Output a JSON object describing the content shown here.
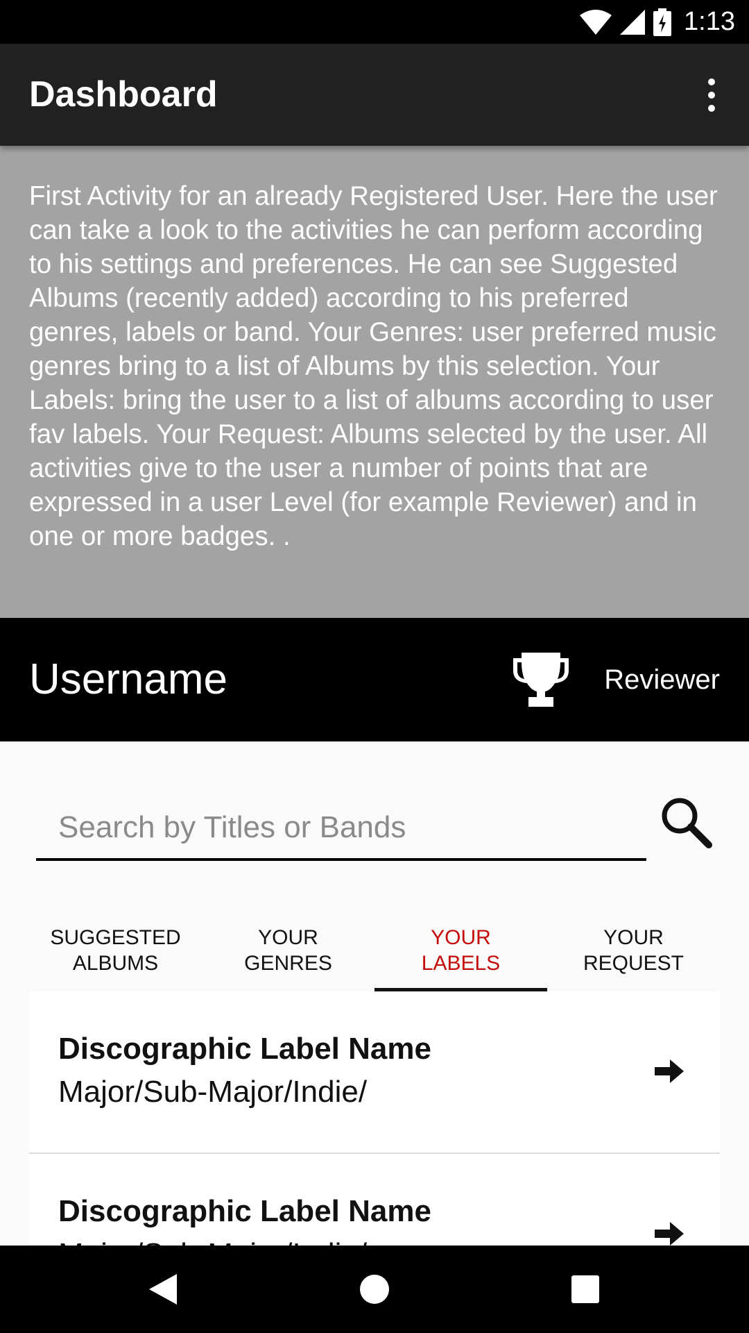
{
  "status_bar": {
    "time": "1:13",
    "icons": [
      "wifi-icon",
      "signal-icon",
      "battery-icon"
    ]
  },
  "app_bar": {
    "title": "Dashboard",
    "menu_icon": "overflow-menu-icon"
  },
  "description": "First Activity for an already Registered User. Here the user can take a look to the activities he can perform according to his settings and preferences. He can see Suggested Albums (recently added) according to his preferred genres, labels or band. Your Genres: user preferred music genres bring to a list of Albums by this selection. Your Labels: bring the user to a list of albums according to user fav labels. Your Request: Albums selected by the user. All activities give to the user a number of points that are expressed in a user Level (for example Reviewer) and in one or more badges. .",
  "user": {
    "name": "Username",
    "level": "Reviewer",
    "badge_icon": "trophy-icon"
  },
  "search": {
    "placeholder": "Search by Titles or Bands",
    "value": ""
  },
  "tabs": [
    {
      "label": "SUGGESTED\nALBUMS",
      "active": false
    },
    {
      "label": "YOUR\nGENRES",
      "active": false
    },
    {
      "label": "YOUR\nLABELS",
      "active": true
    },
    {
      "label": "YOUR\nREQUEST",
      "active": false
    }
  ],
  "list_items": [
    {
      "title": "Discographic Label Name",
      "subtitle": "Major/Sub-Major/Indie/"
    },
    {
      "title": "Discographic Label Name",
      "subtitle": "Major/Sub-Major/Indie/"
    }
  ],
  "colors": {
    "app_bar": "#212121",
    "description_bg": "#a3a3a3",
    "active_tab": "#c40c0c"
  }
}
